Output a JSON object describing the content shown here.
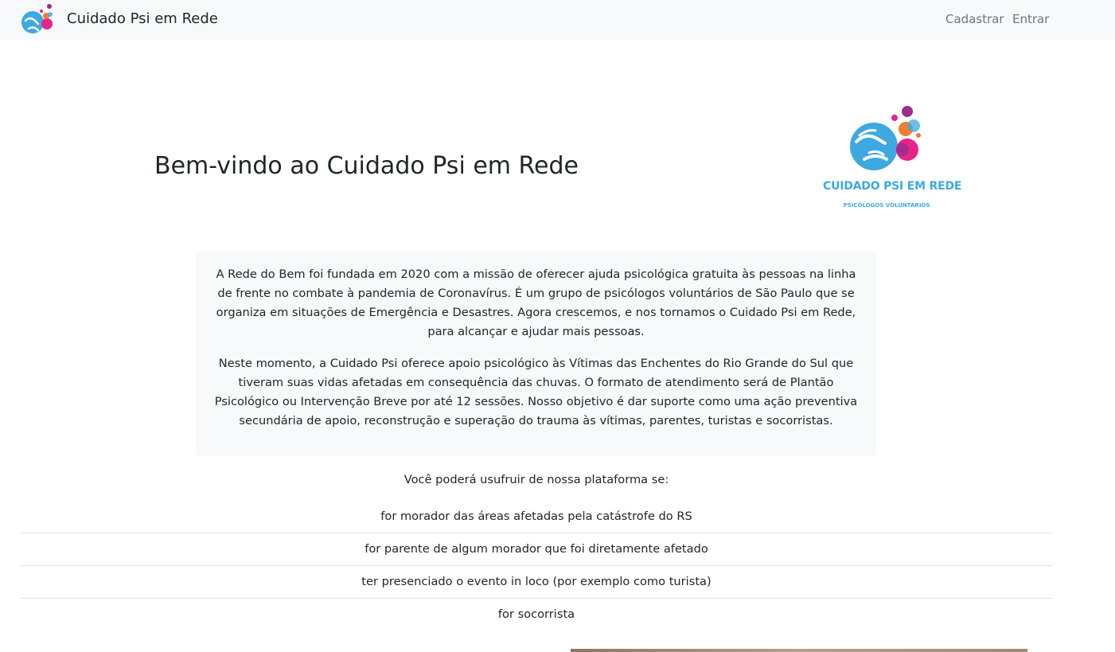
{
  "navbar": {
    "brand": "Cuidado Psi em Rede",
    "links": [
      "Cadastrar",
      "Entrar"
    ],
    "logo_icon": "hands-bubbles-logo-icon"
  },
  "hero": {
    "title": "Bem-vindo ao Cuidado Psi em Rede",
    "logo": {
      "title": "CUIDADO PSI EM REDE",
      "subtitle": "PSICÓLOGOS VOLUNTÁRIOS",
      "icon": "hands-bubbles-logo-icon"
    }
  },
  "about": {
    "paragraph1": "A Rede do Bem foi fundada em 2020 com a missão de oferecer ajuda psicológica gratuita às pessoas na linha de frente no combate à pandemia de Coronavírus. É um grupo de psicólogos voluntários de São Paulo que se organiza em situações de Emergência e Desastres. Agora crescemos, e nos tornamos o Cuidado Psi em Rede, para alcançar e ajudar mais pessoas.",
    "paragraph2": "Neste momento, a Cuidado Psi oferece apoio psicológico às Vítimas das Enchentes do Rio Grande do Sul que tiveram suas vidas afetadas em consequência das chuvas. O formato de atendimento será de Plantão Psicológico ou Intervenção Breve por até 12 sessões. Nosso objetivo é dar suporte como uma ação preventiva secundária de apoio, reconstrução e superação do trauma às vítimas, parentes, turistas e socorristas."
  },
  "eligibility": {
    "intro": "Você poderá usufruir de nossa plataforma se:",
    "items": [
      "for morador das áreas afetadas pela catástrofe do RS",
      "for parente de algum morador que foi diretamente afetado",
      "ter presenciado o evento in loco (por exemplo como turista)",
      "for socorrista"
    ]
  },
  "colors": {
    "brand_blue": "#3da9e0",
    "pink": "#e6248a",
    "purple": "#9b2d8e",
    "orange": "#f07f2d",
    "navbar_bg": "#f8f9fa"
  }
}
